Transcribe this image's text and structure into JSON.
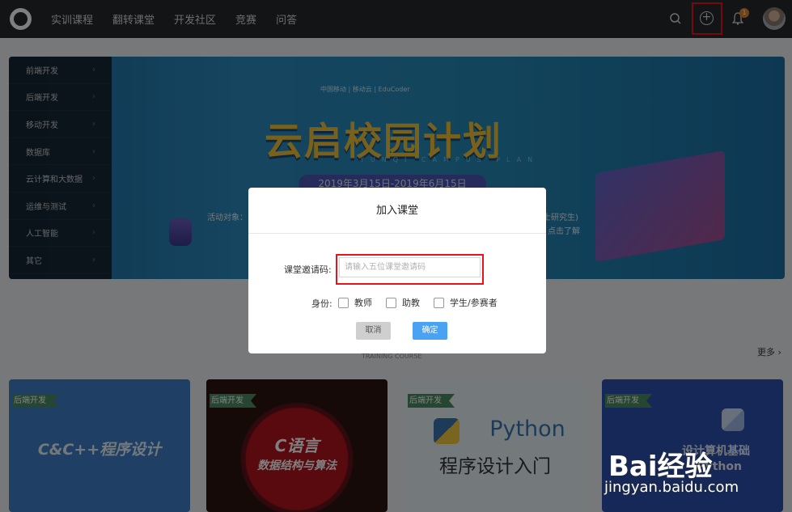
{
  "nav": {
    "items": [
      "实训课程",
      "翻转课堂",
      "开发社区",
      "竞赛",
      "问答"
    ],
    "badge_count": "1"
  },
  "sidebar": {
    "items": [
      "前端开发",
      "后端开发",
      "移动开发",
      "数据库",
      "云计算和大数据",
      "运维与测试",
      "人工智能",
      "其它"
    ]
  },
  "banner": {
    "title": "云启校园计划",
    "subtitle": "YUNQI CAMPUS PLAN",
    "partners": "中国移动  |  移动云  |  EduCoder",
    "date": "2019年3月15日-2019年6月15日",
    "activity": "活动对象：",
    "right_text_1": "士研究生)",
    "right_text_2": "点击了解"
  },
  "section": {
    "subtitle": "TRAINING COURSE",
    "more": "更多 ›"
  },
  "cards": [
    {
      "tag": "后端开发",
      "title": "C&C++程序设计"
    },
    {
      "tag": "后端开发",
      "title": "C语言",
      "subtitle": "数据结构与算法"
    },
    {
      "tag": "后端开发",
      "title": "Python",
      "subtitle": "程序设计入门"
    },
    {
      "tag": "后端开发",
      "title": "设计算机基础",
      "subtitle": "Python"
    }
  ],
  "watermark": {
    "brand": "Bai经验",
    "url": "jingyan.baidu.com"
  },
  "modal": {
    "title": "加入课堂",
    "code_label": "课堂邀请码:",
    "code_placeholder": "请输入五位课堂邀请码",
    "role_label": "身份:",
    "roles": [
      "教师",
      "助教",
      "学生/参赛者"
    ],
    "cancel": "取消",
    "confirm": "确定"
  },
  "colors": {
    "accent": "#4aa3f2",
    "highlight": "#e8141b",
    "topbar": "#24292d"
  }
}
